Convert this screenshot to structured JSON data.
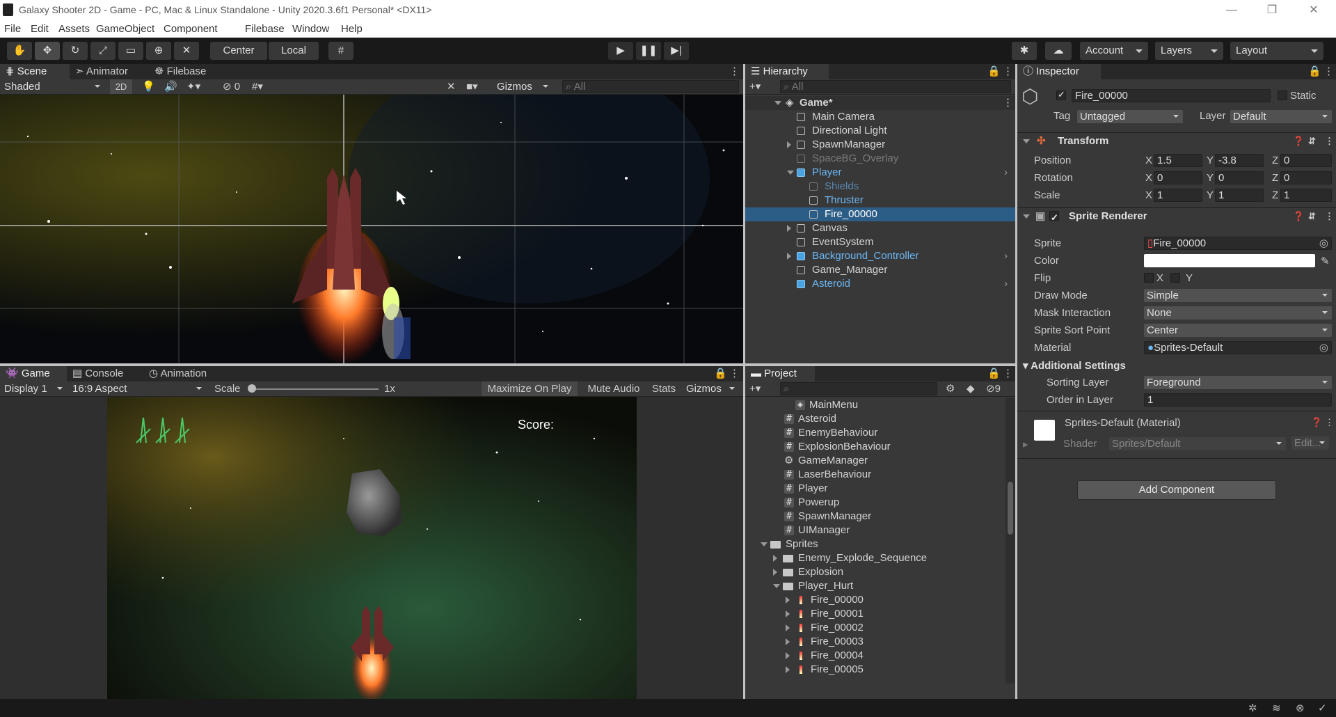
{
  "window": {
    "title": "Galaxy Shooter 2D - Game - PC, Mac & Linux Standalone - Unity 2020.3.6f1 Personal* <DX11>"
  },
  "menu": [
    "File",
    "Edit",
    "Assets",
    "GameObject",
    "Component",
    "Filebase",
    "Window",
    "Help"
  ],
  "toolbar": {
    "center": "Center",
    "local": "Local",
    "account": "Account",
    "layers": "Layers",
    "layout": "Layout"
  },
  "scene": {
    "tabs": [
      "Scene",
      "Animator",
      "Filebase"
    ],
    "shading": "Shaded",
    "mode2d": "2D",
    "hidden_count": "0",
    "gizmos": "Gizmos",
    "search_placeholder": "All"
  },
  "game": {
    "tabs": [
      "Game",
      "Console",
      "Animation"
    ],
    "display": "Display 1",
    "aspect": "16:9 Aspect",
    "scale_label": "Scale",
    "scale_value": "1x",
    "maximize": "Maximize On Play",
    "mute": "Mute Audio",
    "stats": "Stats",
    "gizmos": "Gizmos",
    "score": "Score:"
  },
  "hierarchy": {
    "tab": "Hierarchy",
    "search_placeholder": "All",
    "scene": "Game*",
    "items": [
      "Main Camera",
      "Directional Light",
      "SpawnManager",
      "SpaceBG_Overlay",
      "Player",
      "Shields",
      "Thruster",
      "Fire_00000",
      "Canvas",
      "EventSystem",
      "Background_Controller",
      "Game_Manager",
      "Asteroid"
    ]
  },
  "project": {
    "tab": "Project",
    "hidden_count": "9",
    "items": [
      "MainMenu",
      "Asteroid",
      "EnemyBehaviour",
      "ExplosionBehaviour",
      "GameManager",
      "LaserBehaviour",
      "Player",
      "Powerup",
      "SpawnManager",
      "UIManager",
      "Sprites",
      "Enemy_Explode_Sequence",
      "Explosion",
      "Player_Hurt",
      "Fire_00000",
      "Fire_00001",
      "Fire_00002",
      "Fire_00003",
      "Fire_00004",
      "Fire_00005"
    ]
  },
  "inspector": {
    "tab": "Inspector",
    "name": "Fire_00000",
    "static": "Static",
    "tag_label": "Tag",
    "tag": "Untagged",
    "layer_label": "Layer",
    "layer": "Default",
    "transform": {
      "title": "Transform",
      "position_label": "Position",
      "rotation_label": "Rotation",
      "scale_label": "Scale",
      "px": "1.5",
      "py": "-3.8",
      "pz": "0",
      "rx": "0",
      "ry": "0",
      "rz": "0",
      "sx": "1",
      "sy": "1",
      "sz": "1"
    },
    "sprite_renderer": {
      "title": "Sprite Renderer",
      "sprite_label": "Sprite",
      "sprite": "Fire_00000",
      "color_label": "Color",
      "flip_label": "Flip",
      "draw_mode_label": "Draw Mode",
      "draw_mode": "Simple",
      "mask_label": "Mask Interaction",
      "mask": "None",
      "sort_point_label": "Sprite Sort Point",
      "sort_point": "Center",
      "material_label": "Material",
      "material": "Sprites-Default",
      "additional": "Additional Settings",
      "sorting_layer_label": "Sorting Layer",
      "sorting_layer": "Foreground",
      "order_label": "Order in Layer",
      "order": "1"
    },
    "material": {
      "title": "Sprites-Default (Material)",
      "shader_label": "Shader",
      "shader": "Sprites/Default",
      "edit": "Edit..."
    },
    "add_component": "Add Component"
  }
}
